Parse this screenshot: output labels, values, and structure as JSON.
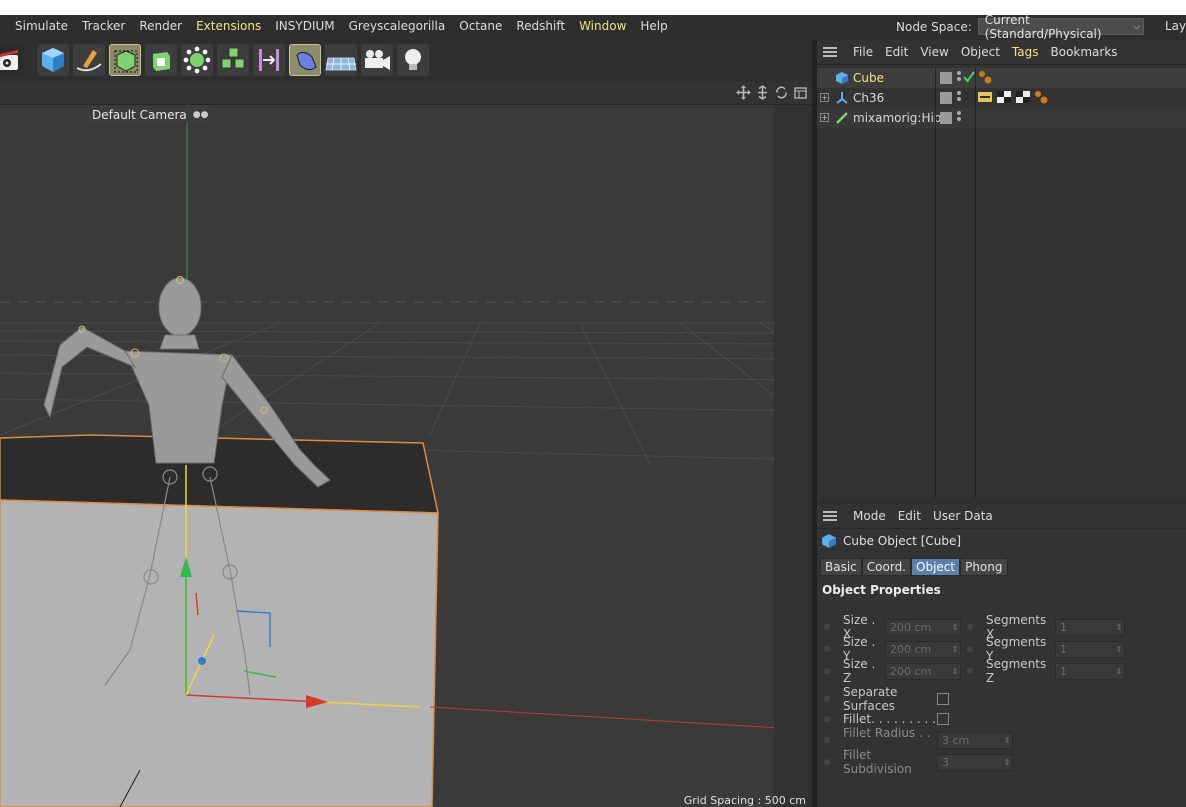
{
  "menubar": {
    "items": [
      "Simulate",
      "Tracker",
      "Render",
      "Extensions",
      "INSYDIUM",
      "Greyscalegorilla",
      "Octane",
      "Redshift",
      "Window",
      "Help"
    ],
    "highlighted": [
      "Extensions",
      "Window"
    ],
    "node_space_label": "Node Space:",
    "node_space_value": "Current (Standard/Physical)",
    "layout_label": "Layo"
  },
  "toolbar": {
    "icons": [
      "clapboard-gear-icon",
      "cube-icon",
      "pen-spline-icon",
      "subdivision-surface-icon",
      "extrude-icon",
      "mograph-cloner-icon",
      "array-icon",
      "deformer-bend-icon",
      "deformer-shear-icon",
      "floor-icon",
      "camera-icon",
      "light-icon"
    ]
  },
  "viewport": {
    "camera_label": "Default Camera",
    "grid_spacing": "Grid Spacing : 500 cm"
  },
  "object_manager": {
    "menu": [
      "File",
      "Edit",
      "View",
      "Object",
      "Tags",
      "Bookmarks"
    ],
    "highlighted": "Tags",
    "objects": [
      {
        "name": "Cube",
        "selected": true
      },
      {
        "name": "Ch36",
        "selected": false
      },
      {
        "name": "mixamorig:Hips",
        "selected": false
      }
    ]
  },
  "attribute_manager": {
    "menu": [
      "Mode",
      "Edit",
      "User Data"
    ],
    "title": "Cube Object [Cube]",
    "tabs": [
      "Basic",
      "Coord.",
      "Object",
      "Phong"
    ],
    "active_tab": "Object",
    "section": "Object Properties",
    "size_x_label": "Size . X",
    "size_x": "200 cm",
    "size_y_label": "Size . Y",
    "size_y": "200 cm",
    "size_z_label": "Size . Z",
    "size_z": "200 cm",
    "seg_x_label": "Segments X",
    "seg_x": "1",
    "seg_y_label": "Segments Y",
    "seg_y": "1",
    "seg_z_label": "Segments Z",
    "seg_z": "1",
    "separate_label": "Separate Surfaces",
    "fillet_label": "Fillet. . . . . . . . .",
    "fillet_radius_label": "Fillet Radius . . .",
    "fillet_radius": "3 cm",
    "fillet_sub_label": "Fillet Subdivision",
    "fillet_sub": "3"
  },
  "colors": {
    "highlight_text": "#f2e37a",
    "active_tab": "#5b7fae",
    "selection_outline": "#e08a3a"
  }
}
